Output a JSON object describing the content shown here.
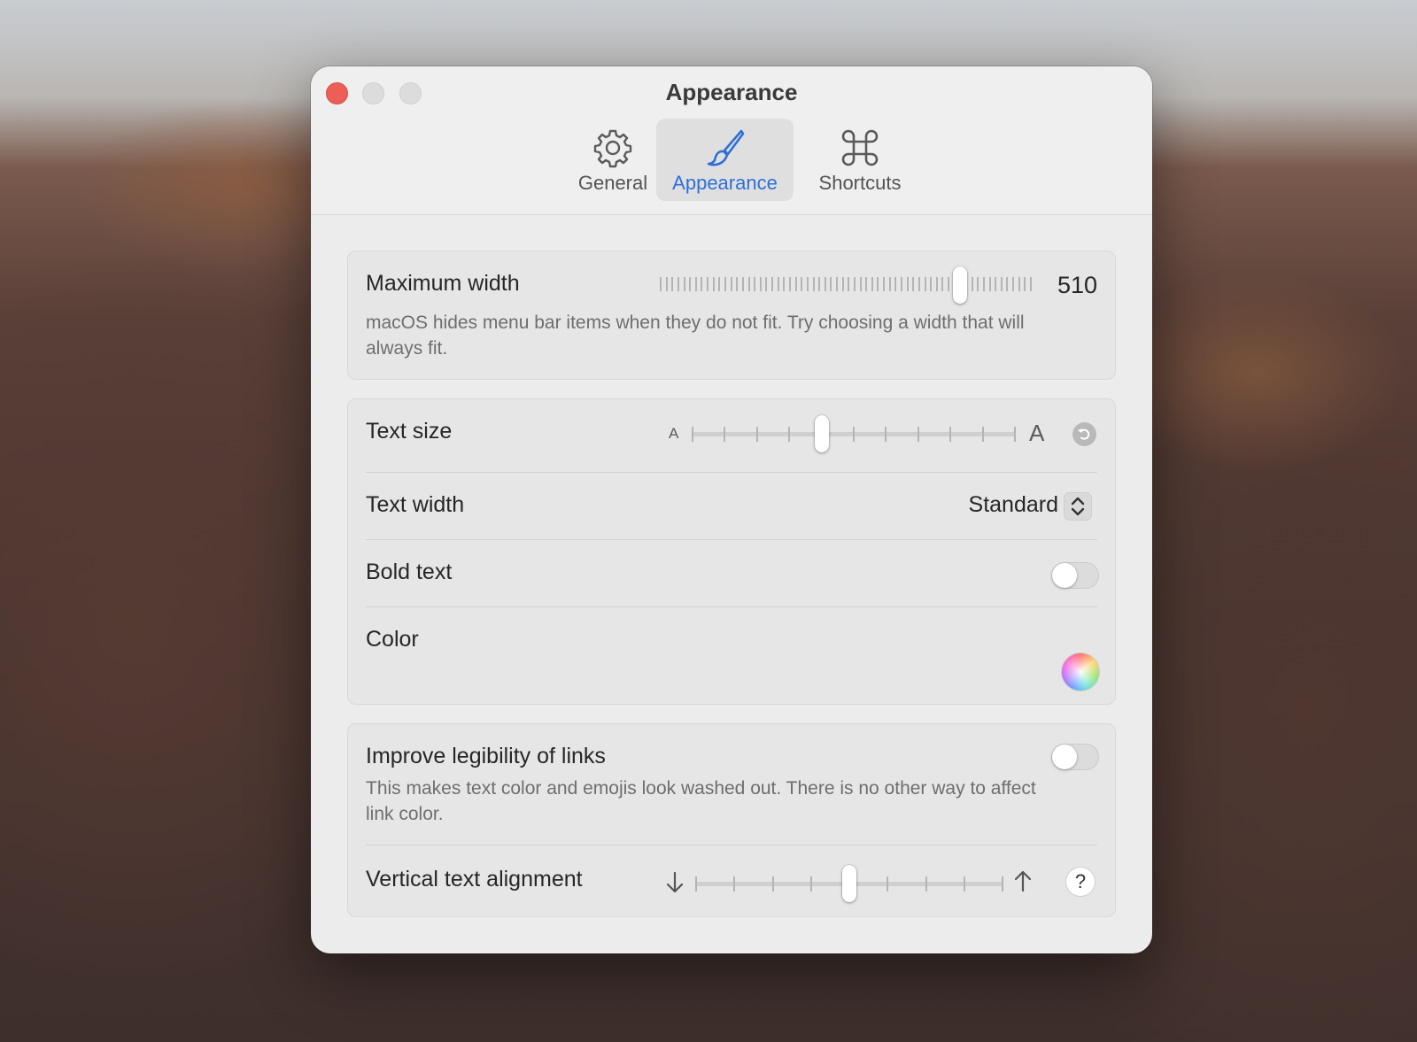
{
  "window": {
    "title": "Appearance"
  },
  "tabs": [
    {
      "label": "General",
      "icon": "gear-icon",
      "active": false
    },
    {
      "label": "Appearance",
      "icon": "paintbrush-icon",
      "active": true
    },
    {
      "label": "Shortcuts",
      "icon": "command-icon",
      "active": false
    }
  ],
  "max_width": {
    "label": "Maximum width",
    "value": "510",
    "slider_fraction": 0.82,
    "description": "macOS hides menu bar items when they do not fit. Try choosing a width that will always fit."
  },
  "text_size": {
    "label": "Text size",
    "small_glyph": "A",
    "large_glyph": "A",
    "slider_step": 4,
    "slider_steps_total": 11
  },
  "text_width": {
    "label": "Text width",
    "value": "Standard"
  },
  "bold_text": {
    "label": "Bold text",
    "enabled": false
  },
  "color": {
    "label": "Color"
  },
  "legibility": {
    "label": "Improve legibility of links",
    "description": "This makes text color and emojis look washed out. There is no other way to affect link color.",
    "enabled": false
  },
  "vertical_alignment": {
    "label": "Vertical text alignment",
    "slider_step": 4,
    "slider_steps_total": 9,
    "help_label": "?"
  },
  "colors": {
    "accent": "#2f6fd6",
    "close": "#ec5f57"
  }
}
